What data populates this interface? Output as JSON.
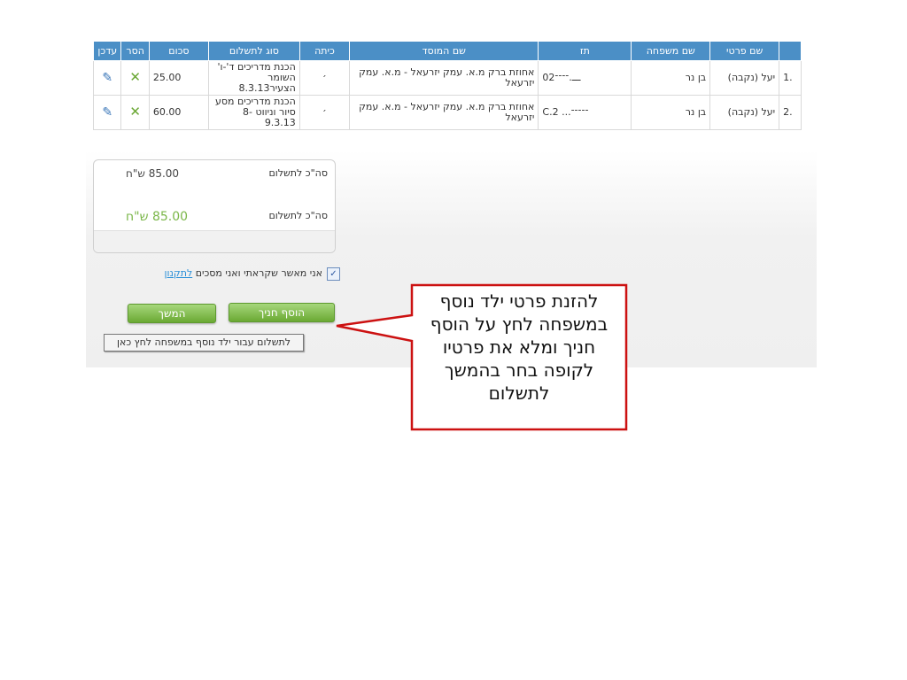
{
  "table": {
    "headers": [
      "שם פרטי",
      "שם משפחה",
      "תז",
      "שם המוסד",
      "כיתה",
      "סוג לתשלום",
      "סכום",
      "הסר",
      "עדכן"
    ],
    "rows": [
      {
        "num": ".1",
        "first_name": "יעל (נקבה)",
        "last_name": "בן נר",
        "id": "0ـــ.־־־־2",
        "institution": "אחוזת ברק מ.א. עמק יזרעאל - מ.א. עמק יזרעאל",
        "class": "׳",
        "payment_type": "הכנת מדריכים ד'-ו' השומר הצעיר8.3.13",
        "amount": "25.00"
      },
      {
        "num": ".2",
        "first_name": "יעל (נקבה)",
        "last_name": "בן נר",
        "id": "C.־־־־־... 2",
        "institution": "אחוזת ברק מ.א. עמק יזרעאל - מ.א. עמק יזרעאל",
        "class": "׳",
        "payment_type": "הכנת מדריכים מסע סיור וניווט 8-9.3.13",
        "amount": "60.00"
      }
    ],
    "remove_icon": "x-icon",
    "edit_icon": "pencil-icon"
  },
  "totals": {
    "line1_label": "סה\"כ לתשלום",
    "line1_value": "85.00",
    "line1_currency": "ש\"ח",
    "line2_label": "סה\"כ לתשלום",
    "line2_value": "85.00",
    "line2_currency": "ש\"ח"
  },
  "agreement": {
    "checked": true,
    "text": "אני מאשר שקראתי ואני מסכים ",
    "link": "לתקנון"
  },
  "buttons": {
    "add_child": "הוסף חניך",
    "continue": "המשך",
    "pay_other": "לתשלום עבור ילד נוסף במשפחה לחץ כאן"
  },
  "callout": {
    "text": "להזנת פרטי ילד נוסף במשפחה לחץ על הוסף חניך ומלא את פרטיו לקופה בחר בהמשך לתשלום"
  },
  "colors": {
    "header_bg": "#4b8fc6",
    "button_green": "#6aa933",
    "callout_border": "#cc1111",
    "total_green": "#7ab648"
  }
}
